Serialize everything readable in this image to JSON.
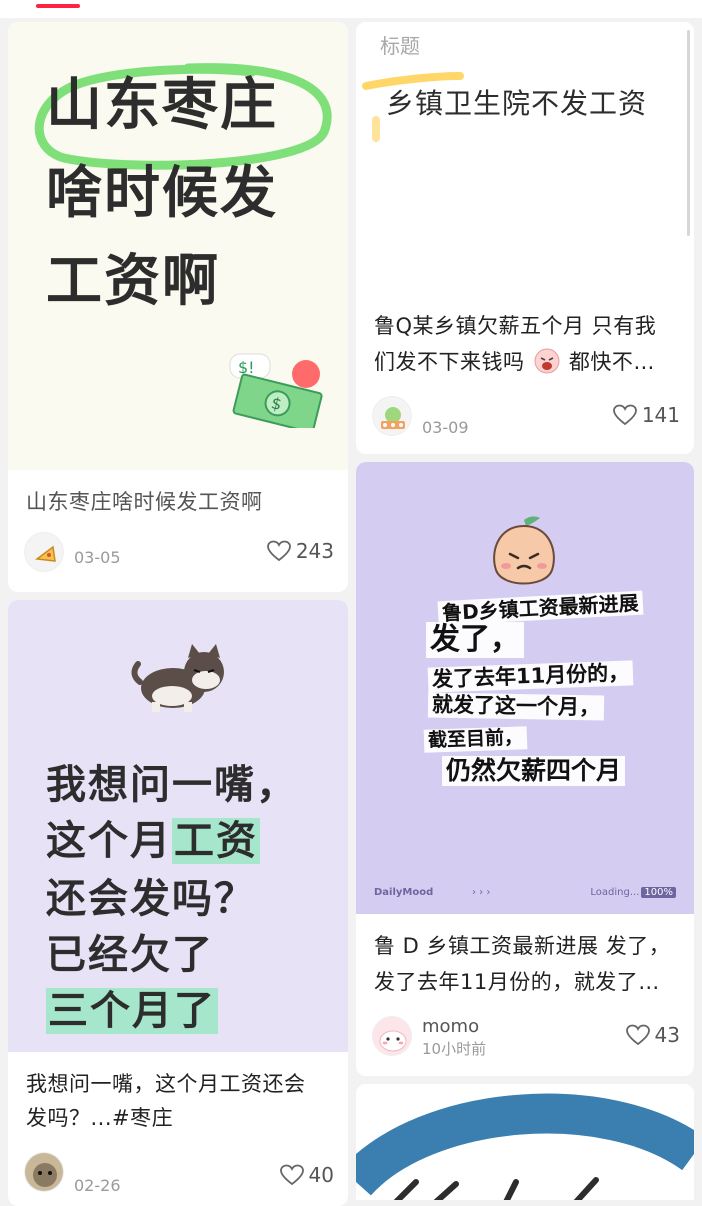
{
  "cards": {
    "c1": {
      "cover_lines": [
        "山东枣庄",
        "啥时候发",
        "工资啊"
      ],
      "title": "山东枣庄啥时候发工资啊",
      "date": "03-05",
      "likes": "243"
    },
    "c2": {
      "cover_label": "标题",
      "cover_text": "乡镇卫生院不发工资",
      "title_line1": "鲁Q某乡镇欠薪五个月 只有我",
      "title_line2": "们发不下来钱吗",
      "title_line2_end": "都快不…",
      "date": "03-09",
      "likes": "141"
    },
    "c3": {
      "cover_line1": "我想问一嘴，",
      "cover_line2_a": "这个月",
      "cover_line2_b": "工资",
      "cover_line3": "还会发吗？",
      "cover_line4": "已经欠了",
      "cover_line5": "三个月了",
      "title_line1": "我想问一嘴，这个月工资还会",
      "title_line2": "发吗？...#枣庄",
      "date": "02-26",
      "likes": "40"
    },
    "c4": {
      "cover_lines": [
        "鲁D乡镇工资最新进展",
        "发了，",
        "发了去年11月份的，",
        "就发了这一个月，",
        "截至目前，",
        "仍然欠薪四个月"
      ],
      "foot_left": "DailyMood",
      "foot_mid": "› › ›",
      "foot_right": "Loading...",
      "foot_tag": "100%",
      "title_line1": "鲁 D 乡镇工资最新进展 发了，",
      "title_line2": "发了去年11月份的，就发了…",
      "author": "momo",
      "time": "10小时前",
      "likes": "43"
    }
  },
  "colors": {
    "accent": "#ff2442",
    "highlight_green": "#a6e6cc",
    "cover_yellow": "#fbfaf0",
    "cover_lavender": "#e8e2f7",
    "cover_purple": "#d5ccf2",
    "bg": "#f2f2f2"
  }
}
